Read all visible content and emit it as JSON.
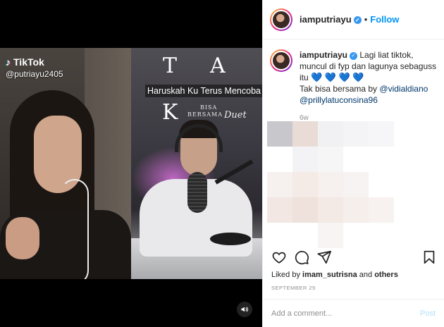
{
  "media": {
    "tiktok_brand": "TikTok",
    "tiktok_user": "@putriayu2405",
    "lyric_letters": [
      "T",
      "A",
      "K"
    ],
    "lyric_line": "Haruskah Ku Terus Mencoba",
    "song_title_line1": "BISA",
    "song_title_line2": "BERSAMA",
    "song_duet": "Duet",
    "sound_icon": "speaker-icon"
  },
  "post_header": {
    "username": "iamputriayu",
    "verified": true,
    "follow_label": "Follow"
  },
  "caption": {
    "username": "iamputriayu",
    "text": "Lagi liat tiktok, muncul di fyp dan lagunya sebaguss itu",
    "hearts": "💙 💙 💙 💙",
    "line2": "Tak bisa bersama by",
    "mention1": "@vidialdiano",
    "mention2": "@prillylatuconsina96",
    "time_ago": "6w"
  },
  "actions": {
    "like_icon": "heart-icon",
    "comment_icon": "comment-icon",
    "share_icon": "paper-plane-icon",
    "save_icon": "bookmark-icon"
  },
  "likes": {
    "prefix": "Liked by",
    "user": "imam_sutrisna",
    "conjunction": "and",
    "others": "others"
  },
  "date": "SEPTEMBER 29",
  "comment": {
    "placeholder": "Add a comment...",
    "post_label": "Post"
  },
  "colors": {
    "accent": "#0095f6",
    "verified": "#3897f0",
    "post_disabled": "#b2dffc",
    "muted": "#8e8e8e",
    "mention": "#00376b"
  }
}
